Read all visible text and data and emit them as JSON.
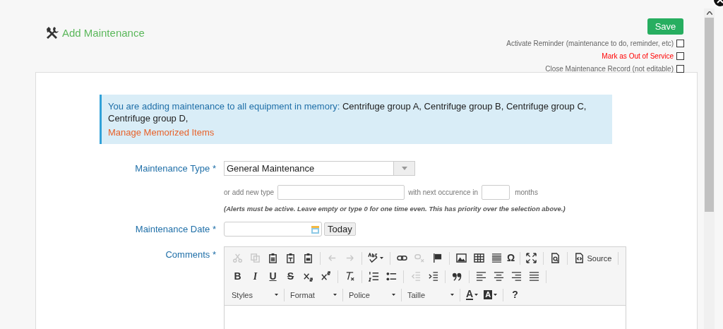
{
  "header": {
    "title": "Add Maintenance"
  },
  "save_button": {
    "label": "Save"
  },
  "options": [
    {
      "label": "Activate Reminder (maintenance to do, reminder, etc)",
      "checked": false,
      "kind": "normal"
    },
    {
      "label": "Mark as Out of Service",
      "checked": false,
      "kind": "warning"
    },
    {
      "label": "Close Maintenance Record (not editable)",
      "checked": false,
      "kind": "normal"
    }
  ],
  "notice": {
    "intro": "You are adding maintenance to all equipment in memory:",
    "items": "Centrifuge group A, Centrifuge group B, Centrifuge group C, Centrifuge group D,",
    "link": "Manage Memorized Items"
  },
  "form": {
    "type": {
      "label": "Maintenance Type *",
      "value": "General Maintenance",
      "add_label": "or add new type",
      "next_label": "with next occurence in",
      "unit": "months",
      "hint": "(Alerts must be active. Leave empty or type 0 for one time even. This has priority over the selection above.)"
    },
    "date": {
      "label": "Maintenance Date *",
      "today": "Today"
    },
    "comments": {
      "label": "Comments *",
      "toolbar": [
        [
          {
            "kind": "button",
            "disabled": true
          },
          {
            "kind": "button",
            "disabled": true
          },
          {
            "kind": "button",
            "disabled": false
          },
          {
            "kind": "button",
            "disabled": false
          },
          {
            "kind": "button",
            "disabled": false
          },
          {
            "kind": "separator"
          },
          {
            "kind": "button",
            "disabled": true
          },
          {
            "kind": "button",
            "disabled": true
          },
          {
            "kind": "separator"
          },
          {
            "kind": "menu_button",
            "disabled": false
          },
          {
            "kind": "separator"
          },
          {
            "kind": "button",
            "disabled": false
          },
          {
            "kind": "button",
            "disabled": true
          },
          {
            "kind": "button",
            "disabled": false
          },
          {
            "kind": "separator"
          },
          {
            "kind": "button",
            "disabled": false
          },
          {
            "kind": "button",
            "disabled": false
          },
          {
            "kind": "button",
            "disabled": false
          },
          {
            "kind": "symbol",
            "label": "Ω",
            "disabled": false
          },
          {
            "kind": "separator"
          },
          {
            "kind": "button",
            "disabled": false
          },
          {
            "kind": "separator"
          },
          {
            "kind": "button",
            "disabled": false
          },
          {
            "kind": "separator"
          },
          {
            "kind": "button",
            "label": "Source",
            "disabled": false
          },
          {
            "kind": "separator"
          }
        ],
        [
          {
            "kind": "bold",
            "label": "B",
            "disabled": false
          },
          {
            "kind": "italic",
            "label": "I",
            "disabled": false
          },
          {
            "kind": "underline",
            "label": "U",
            "disabled": false
          },
          {
            "kind": "strike",
            "label": "S",
            "disabled": false
          },
          {
            "kind": "button",
            "disabled": false
          },
          {
            "kind": "button",
            "disabled": false
          },
          {
            "kind": "separator"
          },
          {
            "kind": "button",
            "disabled": false
          },
          {
            "kind": "separator"
          },
          {
            "kind": "button",
            "disabled": false
          },
          {
            "kind": "button",
            "disabled": false
          },
          {
            "kind": "separator"
          },
          {
            "kind": "button",
            "disabled": true
          },
          {
            "kind": "button",
            "disabled": false
          },
          {
            "kind": "separator"
          },
          {
            "kind": "button",
            "disabled": false
          },
          {
            "kind": "separator"
          },
          {
            "kind": "button",
            "disabled": false
          },
          {
            "kind": "button",
            "disabled": false
          },
          {
            "kind": "button",
            "disabled": false
          },
          {
            "kind": "button",
            "disabled": false
          },
          {
            "kind": "separator"
          }
        ],
        [
          {
            "kind": "combo",
            "label": "Styles"
          },
          {
            "kind": "separator"
          },
          {
            "kind": "combo",
            "label": "Format"
          },
          {
            "kind": "separator"
          },
          {
            "kind": "combo",
            "label": "Police"
          },
          {
            "kind": "separator"
          },
          {
            "kind": "combo",
            "label": "Taille"
          },
          {
            "kind": "separator"
          },
          {
            "kind": "text_color",
            "label": "A"
          },
          {
            "kind": "background_color",
            "label": "A"
          },
          {
            "kind": "separator"
          },
          {
            "kind": "bold",
            "label": "?",
            "disabled": false
          }
        ]
      ]
    }
  }
}
